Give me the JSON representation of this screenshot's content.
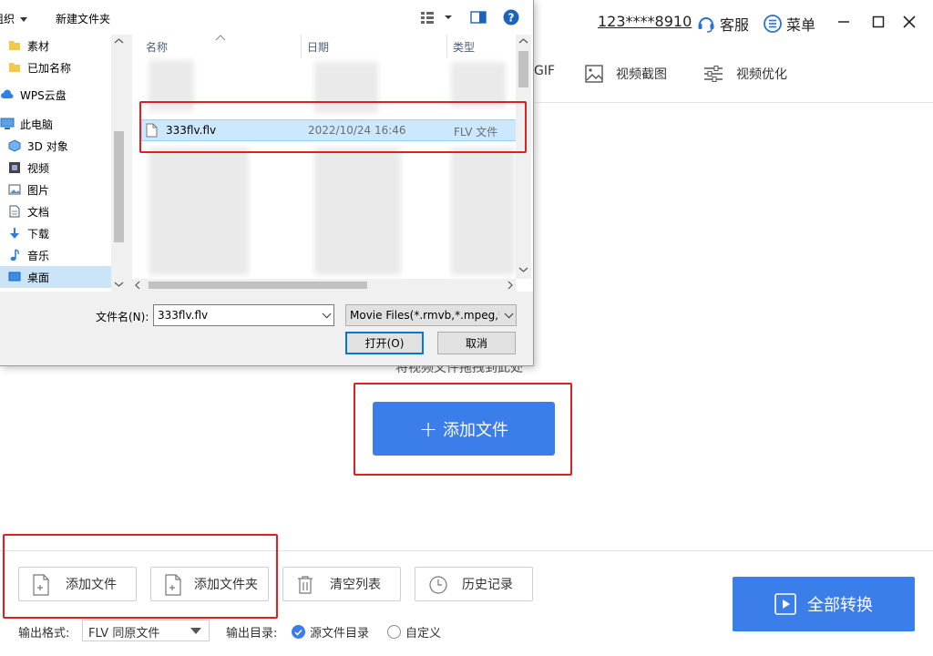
{
  "topbar": {
    "account": "123****8910",
    "service_label": "客服",
    "menu_label": "菜单"
  },
  "tools": {
    "gif_label": "GIF",
    "screenshot_label": "视频截图",
    "optimize_label": "视频优化"
  },
  "drop": {
    "hint": "将视频文件拖拽到此处",
    "add_label": "添加文件"
  },
  "bottom": {
    "add_file": "添加文件",
    "add_folder": "添加文件夹",
    "clear_list": "清空列表",
    "history": "历史记录",
    "convert_all": "全部转换",
    "output_format_label": "输出格式:",
    "output_format_value": "FLV 同原文件",
    "output_dir_label": "输出目录:",
    "dir_source": "源文件目录",
    "dir_custom": "自定义"
  },
  "dialog": {
    "organize": "组织",
    "new_folder": "新建文件夹",
    "nav_items": [
      {
        "label": "素材",
        "icon": "folder-icon"
      },
      {
        "label": "已加名称",
        "icon": "folder-icon"
      },
      {
        "label": "WPS云盘",
        "icon": "cloud-icon"
      },
      {
        "label": "此电脑",
        "icon": "computer-icon"
      },
      {
        "label": "3D 对象",
        "icon": "cube-icon"
      },
      {
        "label": "视频",
        "icon": "video-icon"
      },
      {
        "label": "图片",
        "icon": "picture-icon"
      },
      {
        "label": "文档",
        "icon": "document-icon"
      },
      {
        "label": "下载",
        "icon": "download-icon"
      },
      {
        "label": "音乐",
        "icon": "music-icon"
      },
      {
        "label": "桌面",
        "icon": "desktop-icon"
      }
    ],
    "columns": {
      "name": "名称",
      "date": "日期",
      "type": "类型"
    },
    "selected_file": {
      "name": "333flv.flv",
      "date": "2022/10/24 16:46",
      "type": "FLV 文件"
    },
    "filename_label": "文件名(N):",
    "filename_value": "333flv.flv",
    "filetype_value": "Movie Files(*.rmvb,*.mpeg,*",
    "open_label": "打开(O)",
    "cancel_label": "取消"
  },
  "colors": {
    "accent": "#3b7de9",
    "highlight_box": "#e02020",
    "selection": "#cce8ff"
  }
}
